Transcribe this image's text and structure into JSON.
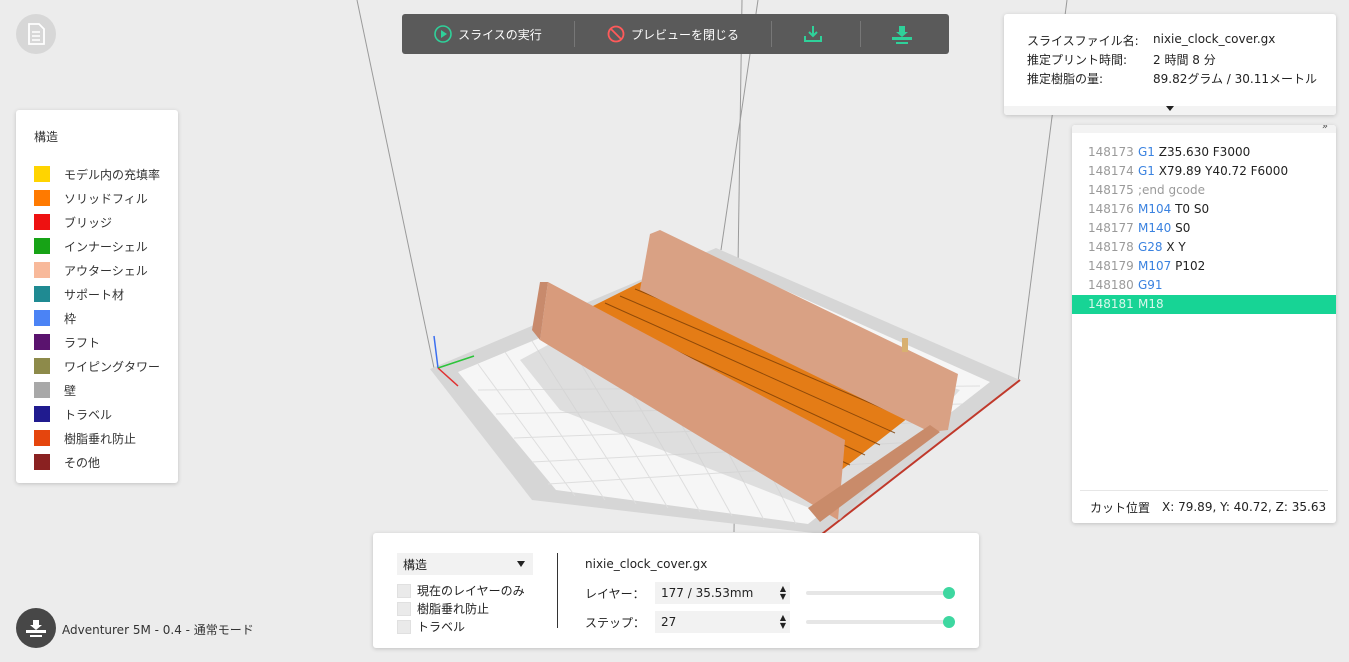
{
  "toolbar": {
    "run_slice": "スライスの実行",
    "close_preview": "プレビューを閉じる",
    "download_icon": "download-icon",
    "printer_icon": "printer-icon",
    "accent": "#2fd19a"
  },
  "legend": {
    "title": "構造",
    "items": [
      {
        "label": "モデル内の充填率",
        "color": "#ffd400"
      },
      {
        "label": "ソリッドフィル",
        "color": "#ff7a00"
      },
      {
        "label": "ブリッジ",
        "color": "#ee1111"
      },
      {
        "label": "インナーシェル",
        "color": "#17a316"
      },
      {
        "label": "アウターシェル",
        "color": "#f8b99a"
      },
      {
        "label": "サポート材",
        "color": "#1f8a92"
      },
      {
        "label": "枠",
        "color": "#4b83f5"
      },
      {
        "label": "ラフト",
        "color": "#5a136e"
      },
      {
        "label": "ワイピングタワー",
        "color": "#8d8a4a"
      },
      {
        "label": "壁",
        "color": "#a8a8a8"
      },
      {
        "label": "トラベル",
        "color": "#201b8f"
      },
      {
        "label": "樹脂垂れ防止",
        "color": "#e5450d"
      },
      {
        "label": "その他",
        "color": "#8a2121"
      }
    ]
  },
  "info": {
    "rows": [
      {
        "k": "スライスファイル名:",
        "v": "nixie_clock_cover.gx"
      },
      {
        "k": "推定プリント時間:",
        "v": "2 時間 8 分"
      },
      {
        "k": "推定樹脂の量:",
        "v": "89.82グラム / 30.11メートル"
      }
    ]
  },
  "gcode": {
    "collapse_glyph": "»",
    "lines": [
      {
        "num": "148173",
        "cmd": "G1",
        "rest": " Z35.630 F3000"
      },
      {
        "num": "148174",
        "cmd": "G1",
        "rest": " X79.89 Y40.72 F6000"
      },
      {
        "num": "148175",
        "cmd": "",
        "rest": ";end gcode",
        "comment": true
      },
      {
        "num": "148176",
        "cmd": "M104",
        "rest": " T0 S0"
      },
      {
        "num": "148177",
        "cmd": "M140",
        "rest": " S0"
      },
      {
        "num": "148178",
        "cmd": "G28",
        "rest": " X Y"
      },
      {
        "num": "148179",
        "cmd": "M107",
        "rest": " P102"
      },
      {
        "num": "148180",
        "cmd": "G91",
        "rest": ""
      },
      {
        "num": "148181",
        "cmd": "M18",
        "rest": "",
        "active": true
      }
    ],
    "cut_label": "カット位置",
    "cut_value": "X: 79.89, Y: 40.72, Z: 35.63"
  },
  "controls": {
    "structure_select": "構造",
    "checkboxes": [
      "現在のレイヤーのみ",
      "樹脂垂れ防止",
      "トラベル"
    ],
    "filename": "nixie_clock_cover.gx",
    "layer_label": "レイヤー：",
    "layer_value": "177 / 35.53mm",
    "step_label": "ステップ：",
    "step_value": "27",
    "layer_slider_fraction": 1.0,
    "step_slider_fraction": 1.0
  },
  "printer": {
    "label": "Adventurer 5M - 0.4 - 通常モード"
  }
}
